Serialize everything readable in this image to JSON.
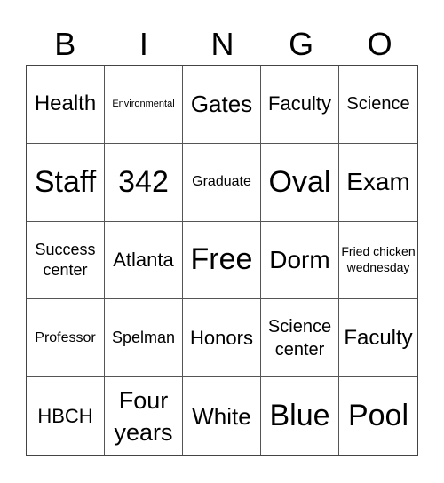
{
  "header": [
    "B",
    "I",
    "N",
    "G",
    "O"
  ],
  "cells": [
    "Health",
    "Environmental",
    "Gates",
    "Faculty",
    "Science",
    "Staff",
    "342",
    "Graduate",
    "Oval",
    "Exam",
    "Success center",
    "Atlanta",
    "Free",
    "Dorm",
    "Fried chicken wednesday",
    "Professor",
    "Spelman",
    "Honors",
    "Science center",
    "Faculty",
    "HBCH",
    "Four years",
    "White",
    "Blue",
    "Pool"
  ]
}
